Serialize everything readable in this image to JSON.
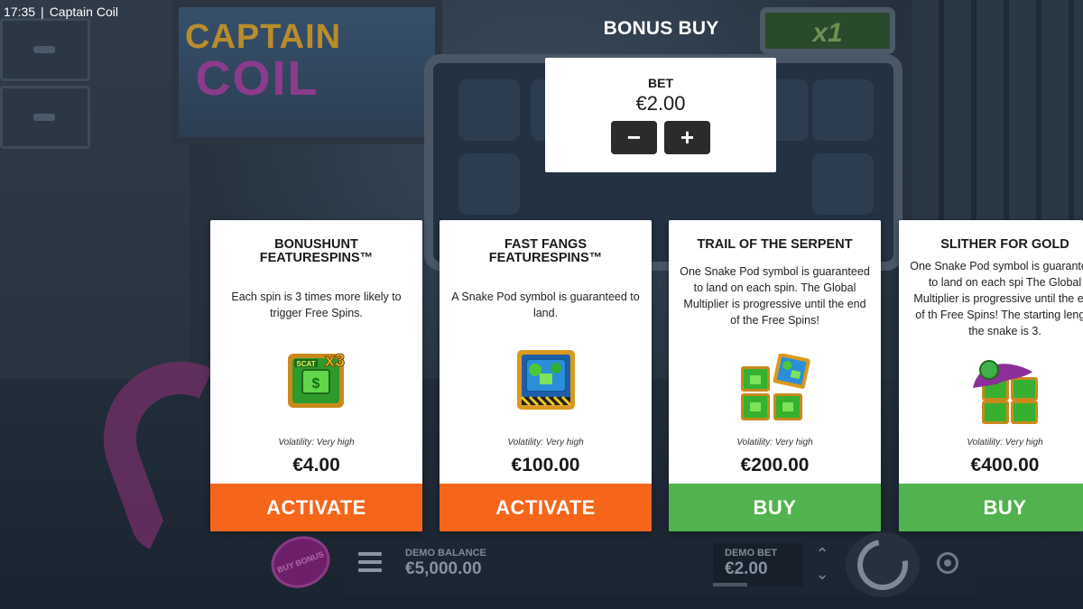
{
  "status_bar": {
    "time": "17:35",
    "separator": "|",
    "app_name": "Captain Coil"
  },
  "logo": {
    "line1": "CAPTAIN",
    "line2": "COIL"
  },
  "background": {
    "multiplier": "x1"
  },
  "modal": {
    "title": "BONUS BUY",
    "bet": {
      "label": "BET",
      "value": "€2.00",
      "decrease": "−",
      "increase": "+"
    }
  },
  "cards": [
    {
      "title": "BONUSHUNT\nFEATURESPINS™",
      "description": "Each spin is 3 times more likely to trigger Free Spins.",
      "icon": "scatter-x3-icon",
      "volatility": "Volatility: Very high",
      "price": "€4.00",
      "button": "ACTIVATE"
    },
    {
      "title": "FAST FANGS\nFEATURESPINS™",
      "description": "A Snake Pod symbol is guaranteed to land.",
      "icon": "snake-pod-icon",
      "volatility": "Volatility: Very high",
      "price": "€100.00",
      "button": "ACTIVATE"
    },
    {
      "title": "TRAIL OF THE SERPENT",
      "description": "One Snake Pod symbol is guaranteed to land on each spin. The Global Multiplier is progressive until the end of the Free Spins!",
      "icon": "scatter-pods-icon",
      "volatility": "Volatility: Very high",
      "price": "€200.00",
      "button": "BUY"
    },
    {
      "title": "SLITHER FOR GOLD",
      "description": "One Snake Pod symbol is guaranteed to land on each spi The Global Multiplier is progressive until the end of th Free Spins! The starting length the snake is 3.",
      "icon": "snake-scatters-icon",
      "volatility": "Volatility: Very high",
      "price": "€400.00",
      "button": "BUY"
    }
  ],
  "bottom_bar": {
    "buy_bonus": "BUY BONUS",
    "balance_label": "DEMO BALANCE",
    "balance_value": "€5,000.00",
    "bet_label": "DEMO BET",
    "bet_value": "€2.00",
    "bet_up": "⌃",
    "bet_down": "⌄"
  },
  "colors": {
    "activate": "#f6661a",
    "buy": "#52b34e",
    "card_bg": "#ffffff"
  }
}
